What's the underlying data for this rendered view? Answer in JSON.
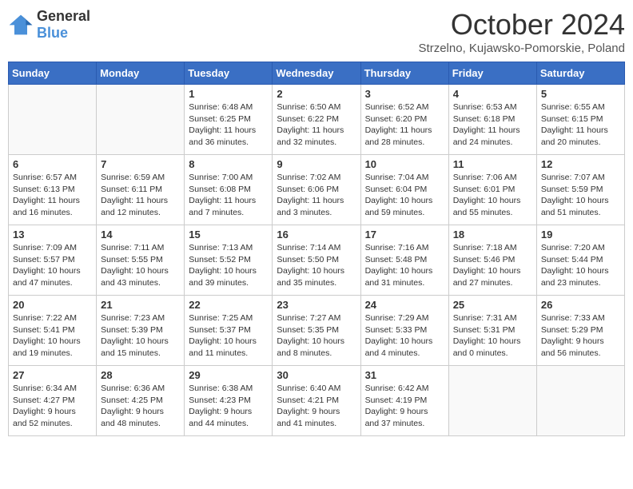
{
  "header": {
    "logo_general": "General",
    "logo_blue": "Blue",
    "month_title": "October 2024",
    "location": "Strzelno, Kujawsko-Pomorskie, Poland"
  },
  "days_of_week": [
    "Sunday",
    "Monday",
    "Tuesday",
    "Wednesday",
    "Thursday",
    "Friday",
    "Saturday"
  ],
  "weeks": [
    [
      {
        "day": "",
        "info": ""
      },
      {
        "day": "",
        "info": ""
      },
      {
        "day": "1",
        "info": "Sunrise: 6:48 AM\nSunset: 6:25 PM\nDaylight: 11 hours\nand 36 minutes."
      },
      {
        "day": "2",
        "info": "Sunrise: 6:50 AM\nSunset: 6:22 PM\nDaylight: 11 hours\nand 32 minutes."
      },
      {
        "day": "3",
        "info": "Sunrise: 6:52 AM\nSunset: 6:20 PM\nDaylight: 11 hours\nand 28 minutes."
      },
      {
        "day": "4",
        "info": "Sunrise: 6:53 AM\nSunset: 6:18 PM\nDaylight: 11 hours\nand 24 minutes."
      },
      {
        "day": "5",
        "info": "Sunrise: 6:55 AM\nSunset: 6:15 PM\nDaylight: 11 hours\nand 20 minutes."
      }
    ],
    [
      {
        "day": "6",
        "info": "Sunrise: 6:57 AM\nSunset: 6:13 PM\nDaylight: 11 hours\nand 16 minutes."
      },
      {
        "day": "7",
        "info": "Sunrise: 6:59 AM\nSunset: 6:11 PM\nDaylight: 11 hours\nand 12 minutes."
      },
      {
        "day": "8",
        "info": "Sunrise: 7:00 AM\nSunset: 6:08 PM\nDaylight: 11 hours\nand 7 minutes."
      },
      {
        "day": "9",
        "info": "Sunrise: 7:02 AM\nSunset: 6:06 PM\nDaylight: 11 hours\nand 3 minutes."
      },
      {
        "day": "10",
        "info": "Sunrise: 7:04 AM\nSunset: 6:04 PM\nDaylight: 10 hours\nand 59 minutes."
      },
      {
        "day": "11",
        "info": "Sunrise: 7:06 AM\nSunset: 6:01 PM\nDaylight: 10 hours\nand 55 minutes."
      },
      {
        "day": "12",
        "info": "Sunrise: 7:07 AM\nSunset: 5:59 PM\nDaylight: 10 hours\nand 51 minutes."
      }
    ],
    [
      {
        "day": "13",
        "info": "Sunrise: 7:09 AM\nSunset: 5:57 PM\nDaylight: 10 hours\nand 47 minutes."
      },
      {
        "day": "14",
        "info": "Sunrise: 7:11 AM\nSunset: 5:55 PM\nDaylight: 10 hours\nand 43 minutes."
      },
      {
        "day": "15",
        "info": "Sunrise: 7:13 AM\nSunset: 5:52 PM\nDaylight: 10 hours\nand 39 minutes."
      },
      {
        "day": "16",
        "info": "Sunrise: 7:14 AM\nSunset: 5:50 PM\nDaylight: 10 hours\nand 35 minutes."
      },
      {
        "day": "17",
        "info": "Sunrise: 7:16 AM\nSunset: 5:48 PM\nDaylight: 10 hours\nand 31 minutes."
      },
      {
        "day": "18",
        "info": "Sunrise: 7:18 AM\nSunset: 5:46 PM\nDaylight: 10 hours\nand 27 minutes."
      },
      {
        "day": "19",
        "info": "Sunrise: 7:20 AM\nSunset: 5:44 PM\nDaylight: 10 hours\nand 23 minutes."
      }
    ],
    [
      {
        "day": "20",
        "info": "Sunrise: 7:22 AM\nSunset: 5:41 PM\nDaylight: 10 hours\nand 19 minutes."
      },
      {
        "day": "21",
        "info": "Sunrise: 7:23 AM\nSunset: 5:39 PM\nDaylight: 10 hours\nand 15 minutes."
      },
      {
        "day": "22",
        "info": "Sunrise: 7:25 AM\nSunset: 5:37 PM\nDaylight: 10 hours\nand 11 minutes."
      },
      {
        "day": "23",
        "info": "Sunrise: 7:27 AM\nSunset: 5:35 PM\nDaylight: 10 hours\nand 8 minutes."
      },
      {
        "day": "24",
        "info": "Sunrise: 7:29 AM\nSunset: 5:33 PM\nDaylight: 10 hours\nand 4 minutes."
      },
      {
        "day": "25",
        "info": "Sunrise: 7:31 AM\nSunset: 5:31 PM\nDaylight: 10 hours\nand 0 minutes."
      },
      {
        "day": "26",
        "info": "Sunrise: 7:33 AM\nSunset: 5:29 PM\nDaylight: 9 hours\nand 56 minutes."
      }
    ],
    [
      {
        "day": "27",
        "info": "Sunrise: 6:34 AM\nSunset: 4:27 PM\nDaylight: 9 hours\nand 52 minutes."
      },
      {
        "day": "28",
        "info": "Sunrise: 6:36 AM\nSunset: 4:25 PM\nDaylight: 9 hours\nand 48 minutes."
      },
      {
        "day": "29",
        "info": "Sunrise: 6:38 AM\nSunset: 4:23 PM\nDaylight: 9 hours\nand 44 minutes."
      },
      {
        "day": "30",
        "info": "Sunrise: 6:40 AM\nSunset: 4:21 PM\nDaylight: 9 hours\nand 41 minutes."
      },
      {
        "day": "31",
        "info": "Sunrise: 6:42 AM\nSunset: 4:19 PM\nDaylight: 9 hours\nand 37 minutes."
      },
      {
        "day": "",
        "info": ""
      },
      {
        "day": "",
        "info": ""
      }
    ]
  ]
}
